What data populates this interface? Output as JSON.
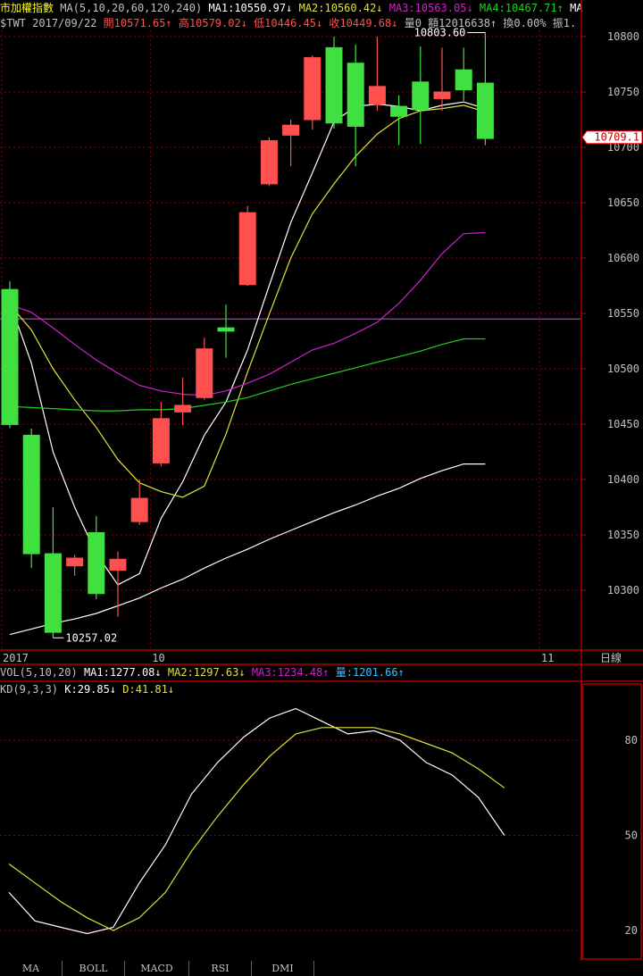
{
  "header": {
    "title": "市加權指數",
    "ma_spec": "MA(5,10,20,60,120,240)",
    "ma1": "MA1:10550.97↓",
    "ma2": "MA2:10560.42↓",
    "ma3": "MA3:10563.05↓",
    "ma4": "MA4:10467.71↑",
    "ma5": "MA",
    "symbol": "$TWT",
    "date": "2017/09/22",
    "open": "開10571.65↑",
    "high": "高10579.02↓",
    "low": "低10446.45↓",
    "close": "收10449.68↓",
    "volume": "量0",
    "amount": "額12016638↑",
    "turnover": "換0.00%",
    "amplitude": "振1."
  },
  "vol_header": {
    "spec": "VOL(5,10,20)",
    "ma1": "MA1:1277.08↓",
    "ma2": "MA2:1297.63↓",
    "ma3": "MA3:1234.48↑",
    "vol": "量:1201.66↑"
  },
  "kd_header": {
    "spec": "KD(9,3,3)",
    "k": "K:29.85↓",
    "d": "D:41.81↓"
  },
  "tabs": [
    "MA",
    "BOLL",
    "MACD",
    "RSI",
    "DMI"
  ],
  "colors": {
    "up": "#ff5050",
    "down": "#40e040",
    "ma1": "#ffffff",
    "ma2": "#e0e040",
    "ma3": "#d020d0",
    "ma4": "#20d020",
    "ma5": "#ffffff",
    "grid": "#8b0000",
    "axis": "#b00000",
    "ref_line": "#c040c0",
    "current_price_box": "#ffffff"
  },
  "chart_data": [
    {
      "type": "candlestick",
      "title": "市加權指數",
      "y_ticks": [
        10300,
        10350,
        10400,
        10450,
        10500,
        10550,
        10600,
        10650,
        10700,
        10750,
        10800
      ],
      "ylim": [
        10245,
        10830
      ],
      "x_labels": [
        {
          "index": 0,
          "text": "2017"
        },
        {
          "index": 7,
          "text": "10"
        },
        {
          "index": 25,
          "text": "11"
        }
      ],
      "period_label": "日線",
      "current_price": "10709.1",
      "annotations": [
        {
          "index": 2,
          "value": 10257.02,
          "text": "10257.02"
        },
        {
          "index": 22,
          "value": 10803.6,
          "text": "10803.60"
        }
      ],
      "reference_line": 10545,
      "candles": [
        {
          "o": 10571.65,
          "h": 10579.02,
          "l": 10446.45,
          "c": 10449.68
        },
        {
          "o": 10440,
          "h": 10446,
          "l": 10320,
          "c": 10333
        },
        {
          "o": 10333,
          "h": 10375,
          "l": 10257.02,
          "c": 10262
        },
        {
          "o": 10322,
          "h": 10332,
          "l": 10313,
          "c": 10329
        },
        {
          "o": 10352,
          "h": 10367,
          "l": 10292,
          "c": 10297
        },
        {
          "o": 10318,
          "h": 10335,
          "l": 10276,
          "c": 10328
        },
        {
          "o": 10362,
          "h": 10400,
          "l": 10359,
          "c": 10383
        },
        {
          "o": 10415,
          "h": 10470,
          "l": 10412,
          "c": 10455
        },
        {
          "o": 10461,
          "h": 10492,
          "l": 10449,
          "c": 10467
        },
        {
          "o": 10474,
          "h": 10528,
          "l": 10472,
          "c": 10518
        },
        {
          "o": 10537,
          "h": 10558,
          "l": 10510,
          "c": 10534
        },
        {
          "o": 10576,
          "h": 10647,
          "l": 10575,
          "c": 10641
        },
        {
          "o": 10667,
          "h": 10709,
          "l": 10665,
          "c": 10706
        },
        {
          "o": 10711,
          "h": 10725,
          "l": 10683,
          "c": 10720
        },
        {
          "o": 10725,
          "h": 10783,
          "l": 10716,
          "c": 10781
        },
        {
          "o": 10790,
          "h": 10800,
          "l": 10717,
          "c": 10722
        },
        {
          "o": 10776,
          "h": 10793,
          "l": 10683,
          "c": 10719
        },
        {
          "o": 10739,
          "h": 10800,
          "l": 10733,
          "c": 10755
        },
        {
          "o": 10737,
          "h": 10747,
          "l": 10702,
          "c": 10728
        },
        {
          "o": 10759,
          "h": 10791,
          "l": 10703,
          "c": 10734
        },
        {
          "o": 10744,
          "h": 10790,
          "l": 10733,
          "c": 10750
        },
        {
          "o": 10770,
          "h": 10790,
          "l": 10742,
          "c": 10752
        },
        {
          "o": 10758,
          "h": 10803.6,
          "l": 10702,
          "c": 10708
        }
      ],
      "series": [
        {
          "name": "MA1",
          "values": [
            10560,
            10505,
            10425,
            10375,
            10333,
            10305,
            10315,
            10365,
            10398,
            10440,
            10470,
            10517,
            10575,
            10632,
            10677,
            10723,
            10737,
            10739,
            10737,
            10733,
            10738,
            10741,
            10735
          ]
        },
        {
          "name": "MA2",
          "values": [
            10558,
            10535,
            10500,
            10472,
            10447,
            10418,
            10397,
            10389,
            10384,
            10394,
            10441,
            10497,
            10549,
            10600,
            10640,
            10667,
            10692,
            10712,
            10726,
            10733,
            10735,
            10738,
            10732
          ]
        },
        {
          "name": "MA3",
          "values": [
            10558,
            10551,
            10537,
            10522,
            10508,
            10496,
            10485,
            10480,
            10477,
            10476,
            10480,
            10487,
            10495,
            10506,
            10517,
            10523,
            10532,
            10542,
            10559,
            10580,
            10604,
            10622,
            10623
          ]
        },
        {
          "name": "MA4",
          "values": [
            10466,
            10465,
            10464,
            10463,
            10462,
            10462,
            10463,
            10463,
            10464,
            10467,
            10470,
            10474,
            10480,
            10486,
            10491,
            10496,
            10501,
            10506,
            10511,
            10516,
            10522,
            10527,
            10527
          ]
        },
        {
          "name": "MA5",
          "values": [
            10260,
            10265,
            10270,
            10274,
            10279,
            10286,
            10293,
            10302,
            10310,
            10320,
            10329,
            10337,
            10346,
            10354,
            10362,
            10370,
            10377,
            10385,
            10392,
            10401,
            10408,
            10414,
            10414
          ]
        }
      ]
    },
    {
      "type": "line",
      "title": "KD(9,3,3)",
      "y_ticks": [
        20,
        50,
        80
      ],
      "ylim": [
        10,
        95
      ],
      "series": [
        {
          "name": "K",
          "values": [
            32,
            23,
            21,
            19,
            21,
            35,
            47,
            63,
            73,
            81,
            87,
            90,
            86,
            82,
            83,
            80,
            73,
            69,
            62,
            50
          ]
        },
        {
          "name": "D",
          "values": [
            41,
            35,
            29,
            24,
            20,
            24,
            32,
            45,
            56,
            66,
            75,
            82,
            84,
            84,
            84,
            82,
            79,
            76,
            71,
            65
          ]
        }
      ]
    }
  ]
}
